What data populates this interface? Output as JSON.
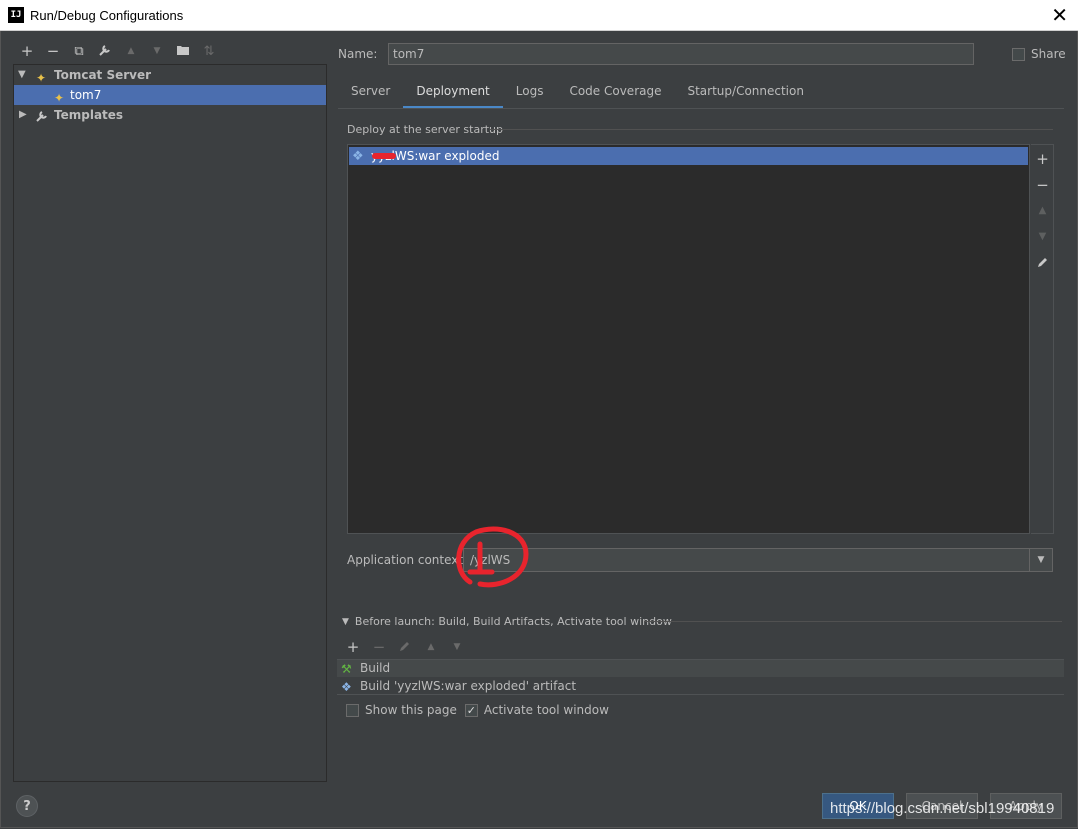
{
  "window": {
    "title": "Run/Debug Configurations",
    "app_icon": "IJ"
  },
  "left_toolbar": [
    {
      "icon": "plus-icon",
      "glyph": "+",
      "enabled": true
    },
    {
      "icon": "minus-icon",
      "glyph": "−",
      "enabled": true
    },
    {
      "icon": "copy-icon",
      "glyph": "⧉",
      "enabled": true
    },
    {
      "icon": "wrench-icon",
      "glyph": "🔧",
      "enabled": true
    },
    {
      "icon": "arrow-up-icon",
      "glyph": "▲",
      "enabled": false
    },
    {
      "icon": "arrow-down-icon",
      "glyph": "▼",
      "enabled": false
    },
    {
      "icon": "folder-icon",
      "glyph": "📁",
      "enabled": true
    },
    {
      "icon": "sort-icon",
      "glyph": "⇅",
      "enabled": false
    }
  ],
  "tree": {
    "tomcat_server": "Tomcat Server",
    "tom7": "tom7",
    "templates": "Templates"
  },
  "name_field": {
    "label": "Name:",
    "value": "tom7"
  },
  "share": {
    "label": "Share",
    "checked": false
  },
  "tabs": [
    {
      "label": "Server",
      "active": false
    },
    {
      "label": "Deployment",
      "active": true
    },
    {
      "label": "Logs",
      "active": false
    },
    {
      "label": "Code Coverage",
      "active": false
    },
    {
      "label": "Startup/Connection",
      "active": false
    }
  ],
  "deployment": {
    "section_title": "Deploy at the server startup",
    "items": [
      "yyzlWS:war exploded"
    ]
  },
  "app_context": {
    "label": "Application context:",
    "value": "/yzlWS"
  },
  "before_launch": {
    "title": "Before launch: Build, Build Artifacts, Activate tool window",
    "items": [
      "Build",
      "Build 'yyzlWS:war exploded' artifact"
    ]
  },
  "options": {
    "show_this_page": {
      "label": "Show this page",
      "checked": false
    },
    "activate_tool_window": {
      "label": "Activate tool window",
      "checked": true
    }
  },
  "buttons": {
    "ok": "OK",
    "cancel": "Cancel",
    "apply": "Apply",
    "help": "?"
  },
  "watermark": "https://blog.csdn.net/sbl19940819",
  "colors": {
    "selection": "#4b6eaf",
    "accent": "#4a88c7",
    "background": "#3c3f41",
    "ok_button": "#365880"
  }
}
